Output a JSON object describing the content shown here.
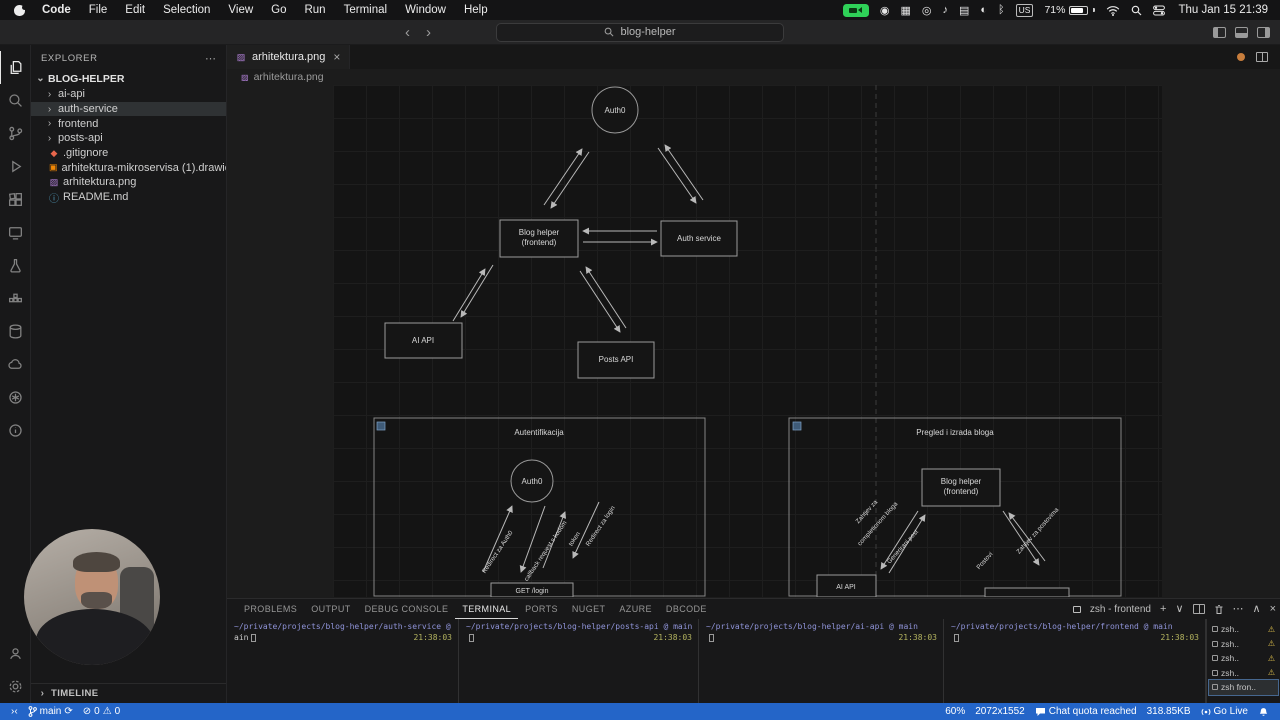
{
  "menubar": {
    "items": [
      "Code",
      "File",
      "Edit",
      "Selection",
      "View",
      "Go",
      "Run",
      "Terminal",
      "Window",
      "Help"
    ],
    "keyboard": "US",
    "battery": "71%",
    "clock": "Thu Jan 15 21:39"
  },
  "titlebar": {
    "search": "blog-helper"
  },
  "sidebar": {
    "header": "EXPLORER",
    "root": "BLOG-HELPER",
    "items": [
      {
        "label": "ai-api"
      },
      {
        "label": "auth-service"
      },
      {
        "label": "frontend"
      },
      {
        "label": "posts-api"
      },
      {
        "label": ".gitignore"
      },
      {
        "label": "arhitektura-mikroservisa (1).drawio"
      },
      {
        "label": "arhitektura.png"
      },
      {
        "label": "README.md"
      }
    ],
    "timeline": "TIMELINE"
  },
  "editor": {
    "tab": "arhitektura.png",
    "breadcrumb": "arhitektura.png"
  },
  "diagram": {
    "auth0": "Auth0",
    "blog1": "Blog helper",
    "blog2": "(frontend)",
    "auth_service": "Auth service",
    "ai_api": "AI API",
    "posts_api": "Posts API",
    "sec1_title": "Autentifikacija",
    "sec1_auth0": "Auth0",
    "sec1_l1": "Redirect za Auth0",
    "sec1_l2": "callback request s kodom",
    "sec1_l3": "token",
    "sec1_l4": "Redirect za login",
    "sec1_get_login": "GET /login",
    "sec2_title": "Pregled i izrada bloga",
    "sec2_blog1": "Blog helper",
    "sec2_blog2": "(frontend)",
    "sec2_ai": "AI API",
    "sec2_l1a": "Zahtjev za",
    "sec2_l1b": "completionom bloga",
    "sec2_l2": "Generirani post",
    "sec2_l3": "Zahtjev za postovima",
    "sec2_l4": "Postovi"
  },
  "terminal": {
    "tabs": [
      "PROBLEMS",
      "OUTPUT",
      "DEBUG CONSOLE",
      "TERMINAL",
      "PORTS",
      "NUGET",
      "AZURE",
      "DBCODE"
    ],
    "session_label": "zsh - frontend",
    "panes": [
      {
        "path": "~/private/projects/blog-helper/auth-service @ m",
        "line2": "ain",
        "time": "21:38:03"
      },
      {
        "path": "~/private/projects/blog-helper/posts-api @ main",
        "line2": "",
        "time": "21:38:03"
      },
      {
        "path": "~/private/projects/blog-helper/ai-api @ main",
        "line2": "",
        "time": "21:38:03"
      },
      {
        "path": "~/private/projects/blog-helper/frontend @ main",
        "line2": "",
        "time": "21:38:03"
      }
    ],
    "sessions": [
      {
        "label": "zsh.."
      },
      {
        "label": "zsh.."
      },
      {
        "label": "zsh.."
      },
      {
        "label": "zsh.."
      },
      {
        "label": "zsh fron.."
      }
    ]
  },
  "statusbar": {
    "branch": "main",
    "errors": "0",
    "warnings": "0",
    "zoom": "60%",
    "dimensions": "2072x1552",
    "chat": "Chat quota reached",
    "filesize": "318.85KB",
    "golive": "Go Live"
  }
}
